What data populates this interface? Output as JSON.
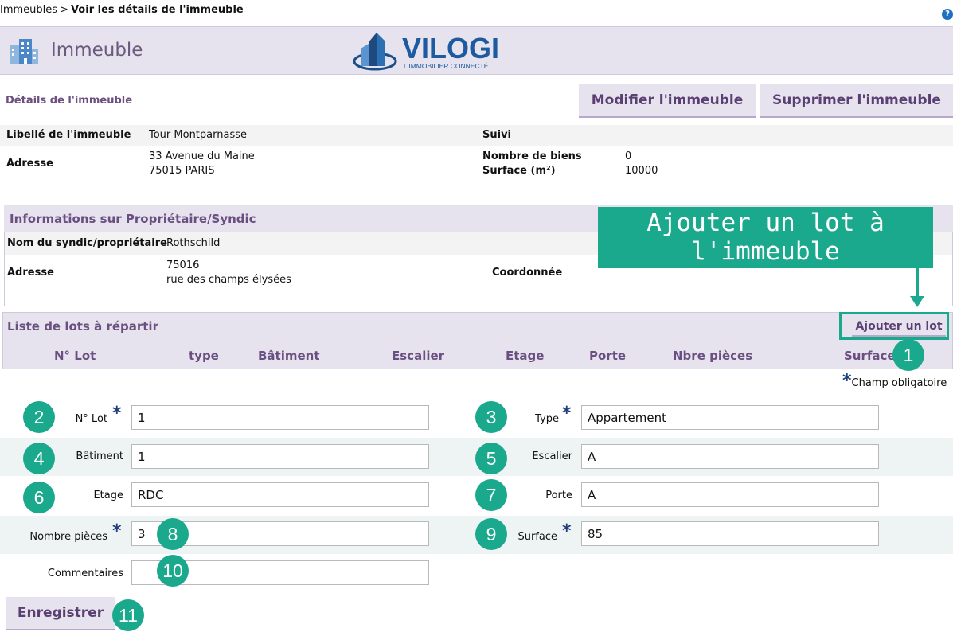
{
  "breadcrumb": {
    "link": "Immeubles",
    "separator": ">",
    "current": "Voir les détails de l'immeuble"
  },
  "help_icon": "?",
  "header": {
    "title": "Immeuble",
    "logo_text": "VILOGI",
    "logo_tagline": "L'IMMOBILIER CONNECTÉ"
  },
  "details": {
    "section_label": "Détails de l'immeuble",
    "modify_button": "Modifier l'immeuble",
    "delete_button": "Supprimer l'immeuble",
    "libelle_label": "Libellé de l'immeuble",
    "libelle_value": "Tour Montparnasse",
    "suivi_label": "Suivi",
    "adresse_label": "Adresse",
    "adresse_line1": "33 Avenue du Maine",
    "adresse_line2": "75015 PARIS",
    "nb_biens_label": "Nombre de biens",
    "nb_biens_value": "0",
    "surface_label": "Surface (m²)",
    "surface_value": "10000"
  },
  "owner": {
    "title": "Informations sur Propriétaire/Syndic",
    "nom_label": "Nom du syndic/propriétaire",
    "nom_value": "Rothschild",
    "adresse_label": "Adresse",
    "adresse_line1": "75016",
    "adresse_line2": "rue des champs élysées",
    "coordonnee_label": "Coordonnée"
  },
  "callout": {
    "line1": "Ajouter un lot à",
    "line2": "l'immeuble"
  },
  "lots": {
    "title": "Liste de lots à répartir",
    "add_button": "Ajouter un lot",
    "columns": [
      "N° Lot",
      "type",
      "Bâtiment",
      "Escalier",
      "Etage",
      "Porte",
      "Nbre pièces",
      "Surface"
    ]
  },
  "form": {
    "required_star": "*",
    "required_note": "Champ obligatoire",
    "lot_label": "N° Lot",
    "lot_value": "1",
    "type_label": "Type",
    "type_value": "Appartement",
    "batiment_label": "Bâtiment",
    "batiment_value": "1",
    "escalier_label": "Escalier",
    "escalier_value": "A",
    "etage_label": "Etage",
    "etage_value": "RDC",
    "porte_label": "Porte",
    "porte_value": "A",
    "pieces_label": "Nombre pièces",
    "pieces_value": "3",
    "surface_label": "Surface",
    "surface_value": "85",
    "commentaires_label": "Commentaires",
    "commentaires_value": "",
    "save_button": "Enregistrer"
  },
  "badges": [
    "1",
    "2",
    "3",
    "4",
    "5",
    "6",
    "7",
    "8",
    "9",
    "10",
    "11"
  ],
  "colors": {
    "accent_green": "#1aa98c",
    "header_bg": "#e6e3ee",
    "purple_text": "#6b4f80"
  }
}
